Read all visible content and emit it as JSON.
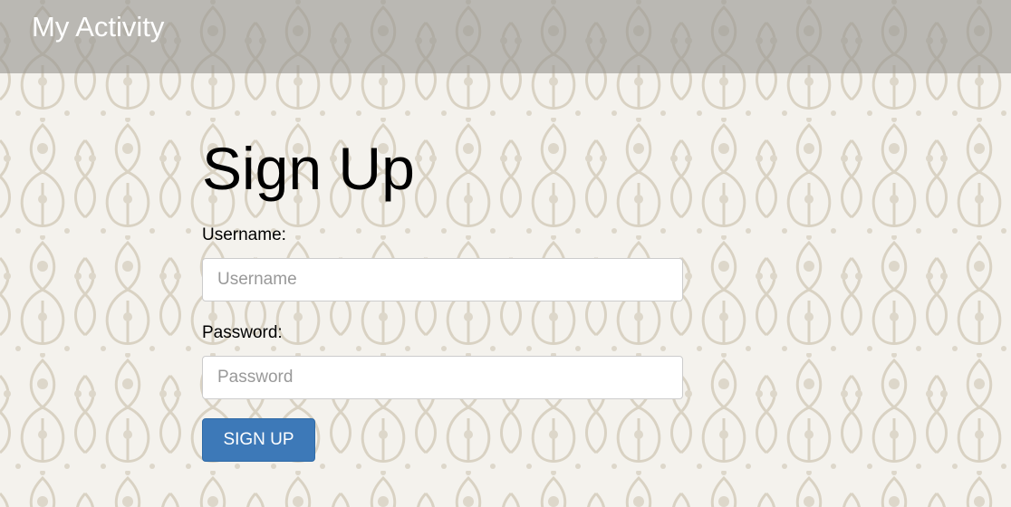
{
  "navbar": {
    "brand": "My Activity"
  },
  "form": {
    "title": "Sign Up",
    "username": {
      "label": "Username:",
      "placeholder": "Username",
      "value": ""
    },
    "password": {
      "label": "Password:",
      "placeholder": "Password",
      "value": ""
    },
    "submit_label": "SIGN UP"
  },
  "colors": {
    "navbar_overlay": "#96948f",
    "background": "#f3f1ec",
    "pattern": "#d8d2c4",
    "button": "#3d79b8",
    "button_text": "#ffffff"
  }
}
